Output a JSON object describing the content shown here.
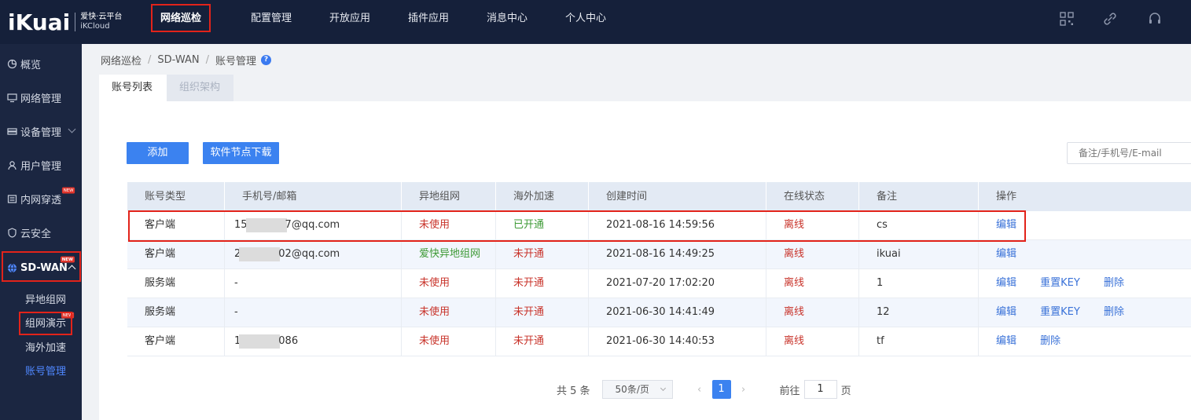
{
  "brand": {
    "logo": "iKuai",
    "line1": "爱快·云平台",
    "line2": "iKCloud"
  },
  "nav": [
    "网络巡检",
    "配置管理",
    "开放应用",
    "插件应用",
    "消息中心",
    "个人中心"
  ],
  "top_icons": [
    "grid-icon",
    "link-icon",
    "headset-icon"
  ],
  "sidebar": {
    "items": [
      "概览",
      "网络管理",
      "设备管理",
      "用户管理",
      "内网穿透",
      "云安全",
      "SD-WAN"
    ],
    "badge": "NEW",
    "sub_items": [
      "异地组网",
      "组网演示",
      "海外加速",
      "账号管理"
    ]
  },
  "breadcrumb": [
    "网络巡检",
    "SD-WAN",
    "账号管理"
  ],
  "tabs": [
    "账号列表",
    "组织架构"
  ],
  "toolbar": {
    "add_label": "添加",
    "download_label": "软件节点下载",
    "search_placeholder": "备注/手机号/E-mail"
  },
  "table": {
    "headers": [
      "账号类型",
      "手机号/邮箱",
      "异地组网",
      "海外加速",
      "创建时间",
      "在线状态",
      "备注",
      "操作"
    ],
    "rows": [
      {
        "type": "客户端",
        "phone_pre": "15",
        "phone_post": "7@qq.com",
        "network": "未使用",
        "overseas": "已开通",
        "created": "2021-08-16 14:59:56",
        "status": "离线",
        "remark": "cs",
        "ops": [
          "编辑"
        ]
      },
      {
        "type": "客户端",
        "phone_pre": "2",
        "phone_post": "02@qq.com",
        "network": "爱快异地组网",
        "overseas": "未开通",
        "created": "2021-08-16 14:49:25",
        "status": "离线",
        "remark": "ikuai",
        "ops": [
          "编辑"
        ]
      },
      {
        "type": "服务端",
        "phone_pre": "-",
        "phone_post": "",
        "network": "未使用",
        "overseas": "未开通",
        "created": "2021-07-20 17:02:20",
        "status": "离线",
        "remark": "1",
        "ops": [
          "编辑",
          "重置KEY",
          "删除"
        ]
      },
      {
        "type": "服务端",
        "phone_pre": "-",
        "phone_post": "",
        "network": "未使用",
        "overseas": "未开通",
        "created": "2021-06-30 14:41:49",
        "status": "离线",
        "remark": "12",
        "ops": [
          "编辑",
          "重置KEY",
          "删除"
        ]
      },
      {
        "type": "客户端",
        "phone_pre": "1",
        "phone_post": "086",
        "network": "未使用",
        "overseas": "未开通",
        "created": "2021-06-30 14:40:53",
        "status": "离线",
        "remark": "tf",
        "ops": [
          "编辑",
          "删除"
        ]
      }
    ]
  },
  "pager": {
    "total": "共 5 条",
    "page_size": "50条/页",
    "current": "1",
    "goto": "前往",
    "goto_value": "1",
    "page_unit": "页"
  },
  "colors": {
    "topbar": "#15203a",
    "sidebar": "#1b2641",
    "accent": "#3b82f0",
    "highlight": "#e2231a"
  }
}
